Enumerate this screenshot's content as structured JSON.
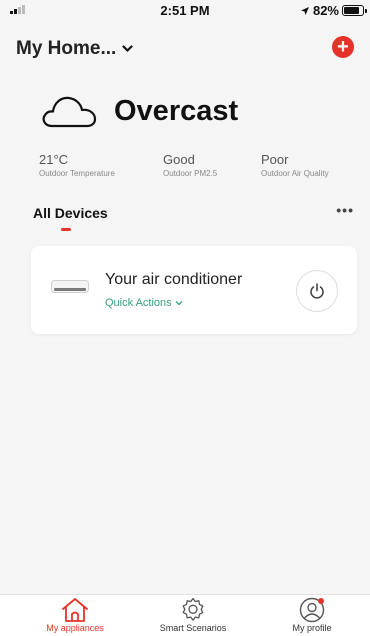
{
  "status_bar": {
    "time": "2:51 PM",
    "battery_percent": "82%",
    "battery_level": 0.82,
    "signal_bars": 2
  },
  "header": {
    "home_name": "My Home...",
    "chevron_icon": "chevron-down-icon",
    "add_icon": "plus-icon"
  },
  "weather": {
    "icon": "cloud-icon",
    "condition": "Overcast",
    "metrics": [
      {
        "value": "21°C",
        "label": "Outdoor Temperature"
      },
      {
        "value": "Good",
        "label": "Outdoor PM2.5"
      },
      {
        "value": "Poor",
        "label": "Outdoor Air Quality"
      }
    ]
  },
  "devices_section": {
    "title": "All Devices",
    "more_icon": "more-dots-icon"
  },
  "device_card": {
    "device_icon": "air-conditioner-icon",
    "name": "Your air conditioner",
    "quick_actions": "Quick Actions",
    "power_icon": "power-icon"
  },
  "tab_bar": {
    "tabs": [
      {
        "label": "My appliances",
        "icon": "home-icon",
        "active": true
      },
      {
        "label": "Smart Scenarios",
        "icon": "gear-icon",
        "active": false
      },
      {
        "label": "My profile",
        "icon": "profile-icon",
        "active": false
      }
    ]
  },
  "colors": {
    "accent_red": "#e5332a",
    "accent_green": "#35a07c",
    "background": "#f5f5f5"
  }
}
